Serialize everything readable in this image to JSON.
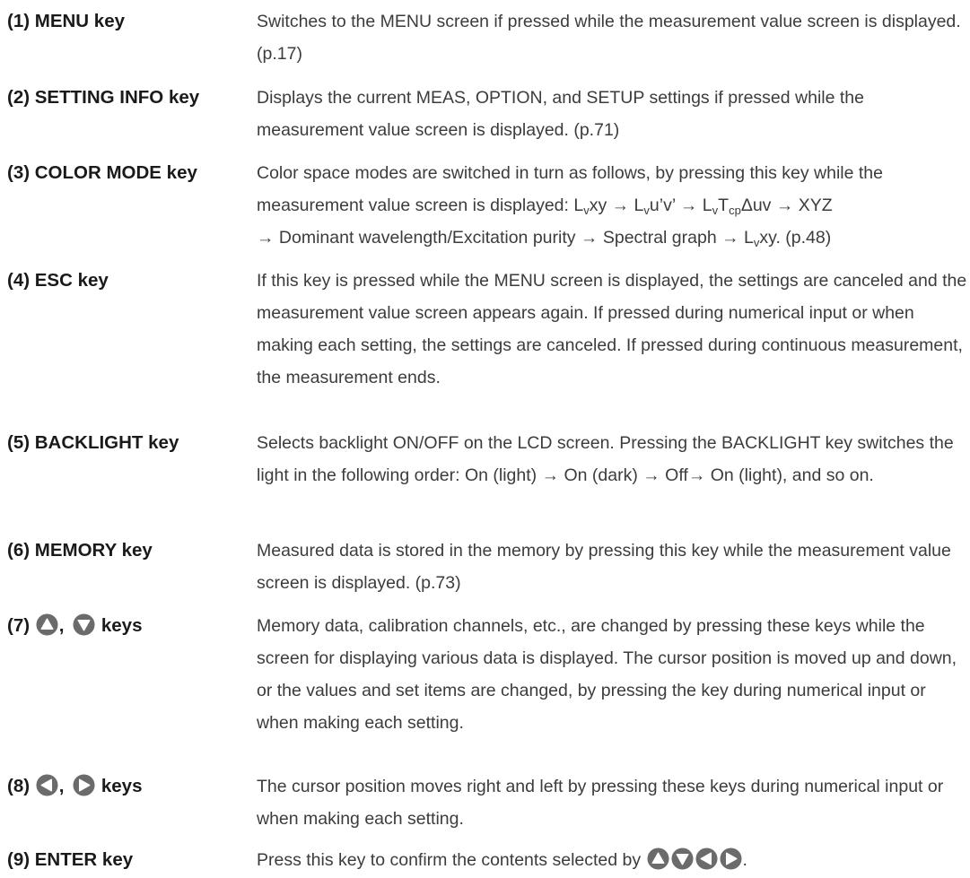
{
  "colors": {
    "key_circle": "#6b6b6b",
    "key_arrow": "#ffffff",
    "term_text": "#1a1a1a",
    "desc_text": "#3c3c3c"
  },
  "entries": [
    {
      "term": "(1) MENU key",
      "desc": "Switches to the MENU screen if pressed while the measurement value screen is displayed. (p.17)"
    },
    {
      "term": "(2) SETTING INFO key",
      "desc": "Displays the current MEAS, OPTION, and SETUP settings if pressed while the measurement value screen is displayed. (p.71)"
    },
    {
      "term": "(3) COLOR MODE key",
      "desc_parts": {
        "intro": "Color space modes are switched in turn as follows, by pressing this key while the measurement value screen is displayed: ",
        "L": "L",
        "v": "v",
        "xy": "xy",
        "arrow": " → ",
        "uv_prime": "u’v’",
        "T": "T",
        "cp": "cp",
        "duv": "Δuv",
        "xyz": "XYZ",
        "dominant": "Dominant wavelength/Excitation purity",
        "spectral": "Spectral graph",
        "end": ". (p.48)"
      }
    },
    {
      "term": "(4) ESC key",
      "desc": "If this key is pressed while the MENU screen is displayed, the settings are canceled and the measurement value screen appears again. If pressed during numerical input or when making each setting, the settings are canceled. If pressed during continuous measurement, the measurement ends."
    },
    {
      "term": "(5) BACKLIGHT key",
      "desc": "Selects backlight ON/OFF on the LCD screen. Pressing the BACKLIGHT key switches the light in the following order: On (light) → On (dark) → Off→ On (light), and so on."
    },
    {
      "term": "(6) MEMORY key",
      "desc": "Measured data is stored in the memory by pressing this key while the measurement value screen is displayed. (p.73)"
    },
    {
      "term_prefix": "(7)",
      "term_sep": ",",
      "term_suffix": "keys",
      "icons": [
        "up-key-icon",
        "down-key-icon"
      ],
      "desc": "Memory data, calibration channels, etc., are changed by pressing these keys while the screen for displaying various data is displayed. The cursor position is moved up and down, or the values and set items are changed, by pressing the key during numerical input or when making each setting."
    },
    {
      "term_prefix": "(8)",
      "term_sep": ",",
      "term_suffix": "keys",
      "icons": [
        "left-key-icon",
        "right-key-icon"
      ],
      "desc": "The cursor position moves right and left by pressing these keys during numerical input or when making each setting."
    },
    {
      "term": "(9) ENTER key",
      "desc_prefix": "Press this key to confirm the contents selected by",
      "desc_suffix": ".",
      "icons": [
        "up-key-icon",
        "down-key-icon",
        "left-key-icon",
        "right-key-icon"
      ]
    }
  ]
}
